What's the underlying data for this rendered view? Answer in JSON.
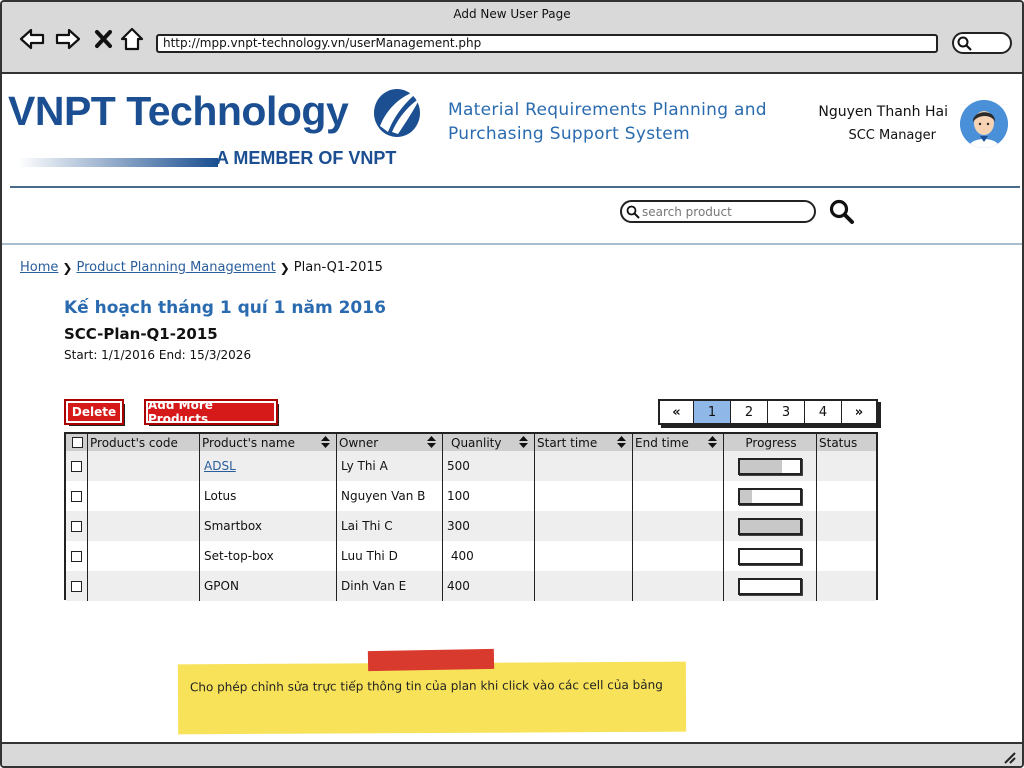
{
  "window": {
    "title": "Add New User Page"
  },
  "browser": {
    "url": "http://mpp.vnpt-technology.vn/userManagement.php",
    "back_icon": "back-arrow-icon",
    "forward_icon": "forward-arrow-icon",
    "stop_icon": "close-icon",
    "home_icon": "home-icon"
  },
  "header": {
    "logo_text": "VNPT Technology",
    "logo_sub": "A MEMBER OF VNPT",
    "system_title_line1": "Material Requirements Planning and",
    "system_title_line2": "Purchasing Support System",
    "user_name": "Nguyen Thanh Hai",
    "user_role": "SCC Manager"
  },
  "search": {
    "placeholder": "search product"
  },
  "breadcrumb": {
    "home": "Home",
    "parent": "Product Planning Management",
    "current": "Plan-Q1-2015"
  },
  "plan": {
    "title": "Kế hoạch tháng 1 quí 1 năm 2016",
    "code": "SCC-Plan-Q1-2015",
    "dates": "Start: 1/1/2016 End: 15/3/2026"
  },
  "actions": {
    "delete_label": "Delete",
    "add_label": "Add More Products"
  },
  "pagination": {
    "prev": "«",
    "pages": [
      "1",
      "2",
      "3",
      "4"
    ],
    "next": "»",
    "active": "1"
  },
  "table": {
    "headers": [
      "Product's code",
      "Product's name",
      "Owner",
      "Quanlity",
      "Start time",
      "End time",
      "Progress",
      "Status"
    ],
    "rows": [
      {
        "code": "",
        "name": "ADSL",
        "owner": "Ly Thi A",
        "quantity": "500",
        "start": "",
        "end": "",
        "progress": 0.7,
        "status": ""
      },
      {
        "code": "",
        "name": "Lotus",
        "owner": "Nguyen Van B",
        "quantity": "100",
        "start": "",
        "end": "",
        "progress": 0.2,
        "status": ""
      },
      {
        "code": "",
        "name": "Smartbox",
        "owner": "Lai Thi C",
        "quantity": "300",
        "start": "",
        "end": "",
        "progress": 1.0,
        "status": ""
      },
      {
        "code": "",
        "name": "Set-top-box",
        "owner": "Luu Thi D",
        "quantity": " 400",
        "start": "",
        "end": "",
        "progress": 0.0,
        "status": ""
      },
      {
        "code": "",
        "name": "GPON",
        "owner": "Dinh Van E",
        "quantity": "400",
        "start": "",
        "end": "",
        "progress": 0.0,
        "status": ""
      }
    ]
  },
  "note": {
    "text": "Cho phép chỉnh sửa trực tiếp thông tin của plan khi click vào các cell của bảng"
  },
  "colors": {
    "accent": "#2a6bb0",
    "brand": "#1b4f91",
    "button": "#d61a1a",
    "note": "#f7e25a",
    "pager_active": "#8fb8e8"
  }
}
